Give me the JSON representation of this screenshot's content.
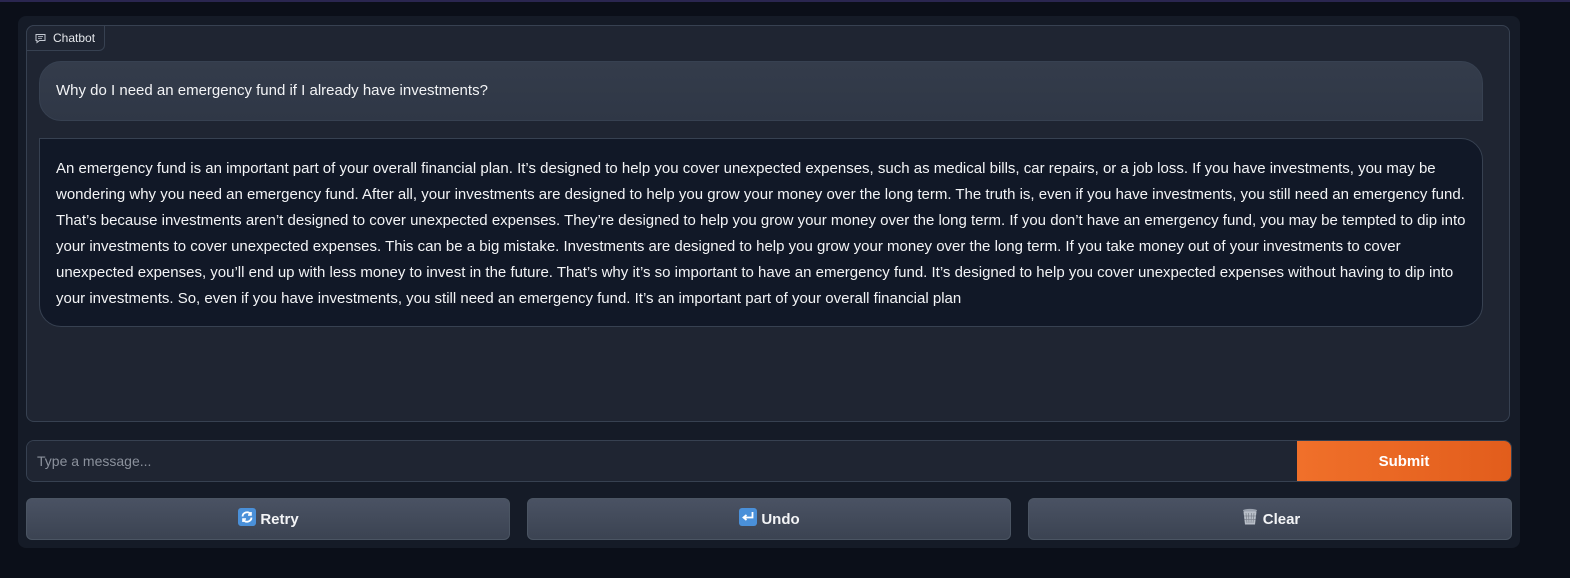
{
  "chatbot": {
    "label": "Chatbot",
    "icon": "chat-icon",
    "messages": [
      {
        "role": "user",
        "text": "Why do I need an emergency fund if I already have investments?"
      },
      {
        "role": "bot",
        "text": "An emergency fund is an important part of your overall financial plan. It’s designed to help you cover unexpected expenses, such as medical bills, car repairs, or a job loss. If you have investments, you may be wondering why you need an emergency fund. After all, your investments are designed to help you grow your money over the long term. The truth is, even if you have investments, you still need an emergency fund. That’s because investments aren’t designed to cover unexpected expenses. They’re designed to help you grow your money over the long term. If you don’t have an emergency fund, you may be tempted to dip into your investments to cover unexpected expenses. This can be a big mistake. Investments are designed to help you grow your money over the long term. If you take money out of your investments to cover unexpected expenses, you’ll end up with less money to invest in the future. That’s why it’s so important to have an emergency fund. It’s designed to help you cover unexpected expenses without having to dip into your investments. So, even if you have investments, you still need an emergency fund. It’s an important part of your overall financial plan"
      }
    ]
  },
  "input": {
    "placeholder": "Type a message...",
    "value": "",
    "submit_label": "Submit"
  },
  "buttons": {
    "retry": {
      "label": "Retry",
      "icon": "retry-icon"
    },
    "undo": {
      "label": "Undo",
      "icon": "undo-icon"
    },
    "clear": {
      "label": "Clear",
      "icon": "wastebasket-icon"
    }
  },
  "colors": {
    "background": "#0b0f19",
    "panel": "#1f2532",
    "accent": "#f0702a",
    "button": "#414959",
    "icon_blue": "#4a90d9"
  }
}
